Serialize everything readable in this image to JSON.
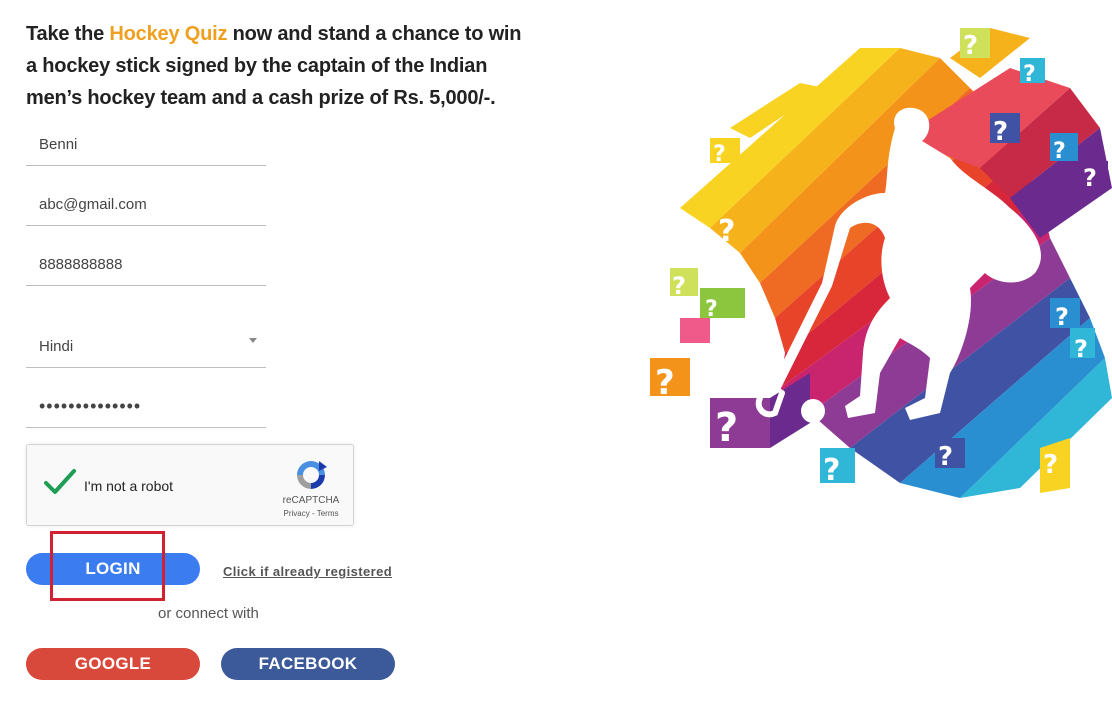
{
  "promo": {
    "text_before": "Take the ",
    "highlight": "Hockey Quiz",
    "text_after": " now and stand a chance to win a hockey stick signed by the captain of the Indian men’s hockey team and a cash prize of Rs. 5,000/-."
  },
  "form": {
    "name_value": "Benni",
    "email_value": "abc@gmail.com",
    "phone_value": "8888888888",
    "language_value": "Hindi",
    "password_mask": "••••••••••••••"
  },
  "captcha": {
    "label": "I'm not a robot",
    "brand": "reCAPTCHA",
    "terms": "Privacy - Terms",
    "checked": true
  },
  "actions": {
    "login_label": "LOGIN",
    "registered_link": "Click if already registered",
    "connect_text": "or connect with",
    "google_label": "GOOGLE",
    "facebook_label": "FACEBOOK"
  },
  "colors": {
    "highlight": "#f0a020",
    "login": "#3b7df0",
    "google": "#d9493b",
    "facebook": "#3c5a99",
    "annotation_box": "#d22232"
  },
  "icons": [
    "checkmark-icon",
    "recaptcha-logo-icon",
    "caret-down-icon",
    "hockey-player-illustration"
  ]
}
